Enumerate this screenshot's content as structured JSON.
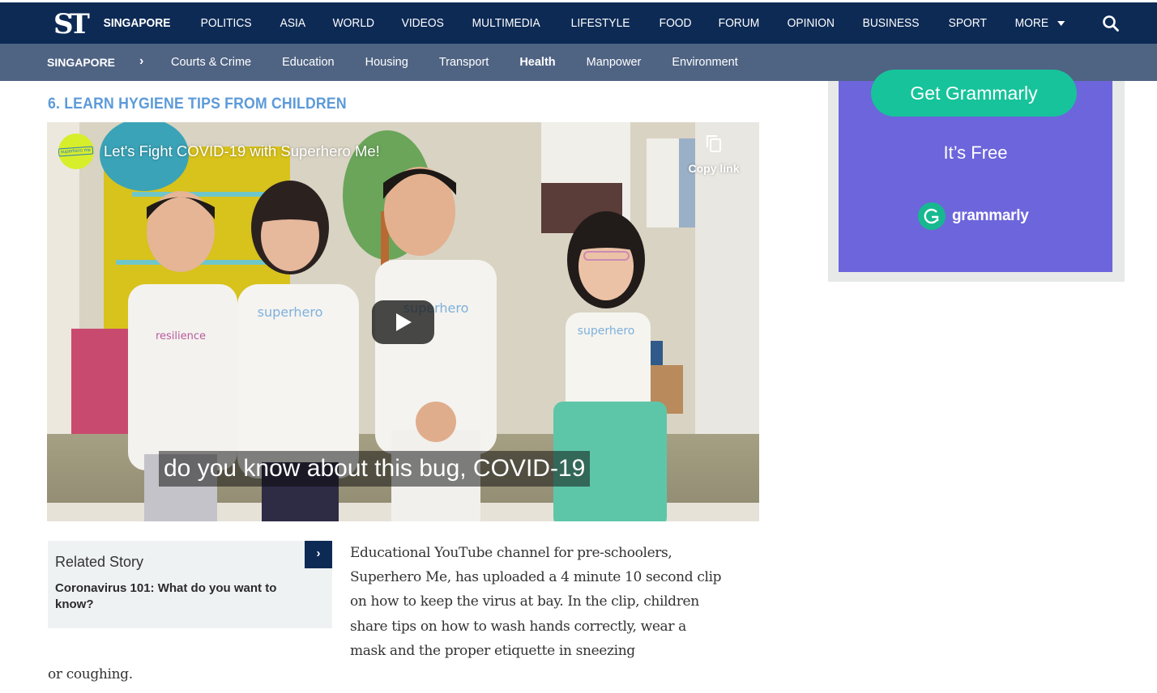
{
  "header": {
    "logo": "ST",
    "nav_items": [
      {
        "label": "SINGAPORE",
        "active": true
      },
      {
        "label": "POLITICS",
        "active": false
      },
      {
        "label": "ASIA",
        "active": false
      },
      {
        "label": "WORLD",
        "active": false
      },
      {
        "label": "VIDEOS",
        "active": false
      },
      {
        "label": "MULTIMEDIA",
        "active": false
      },
      {
        "label": "LIFESTYLE",
        "active": false
      },
      {
        "label": "FOOD",
        "active": false
      },
      {
        "label": "FORUM",
        "active": false
      },
      {
        "label": "OPINION",
        "active": false
      },
      {
        "label": "BUSINESS",
        "active": false
      },
      {
        "label": "SPORT",
        "active": false
      }
    ],
    "more_label": "MORE",
    "search_icon": "search-icon",
    "colors": {
      "nav_bg": "#0d2a55",
      "subnav_bg": "#4f6383"
    }
  },
  "subnav": {
    "section": "SINGAPORE",
    "separator_icon": "chevron-right-icon",
    "items": [
      {
        "label": "Courts & Crime",
        "active": false
      },
      {
        "label": "Education",
        "active": false
      },
      {
        "label": "Housing",
        "active": false
      },
      {
        "label": "Transport",
        "active": false
      },
      {
        "label": "Health",
        "active": true
      },
      {
        "label": "Manpower",
        "active": false
      },
      {
        "label": "Environment",
        "active": false
      }
    ]
  },
  "article": {
    "section_heading": "6. LEARN HYGIENE TIPS FROM CHILDREN",
    "heading_color": "#5c9ad8",
    "video": {
      "channel_avatar_text": "superhero me",
      "title": "Let's Fight COVID-19 with Superhero Me!",
      "copy_link_label": "Copy link",
      "caption": "do you know about this bug, COVID-19",
      "play_icon": "play-icon"
    },
    "related_story": {
      "label": "Related Story",
      "title": "Coronavirus 101: What do you want to know?",
      "arrow": "›"
    },
    "body": "Educational YouTube channel for pre-schoolers, Superhero Me, has uploaded a 4 minute 10 second clip on how to keep the virus at bay. In the clip, children share tips on how to wash hands correctly, wear a mask and the proper etiquette in sneezing",
    "body_tail": "or coughing."
  },
  "ad": {
    "cta_label": "Get Grammarly",
    "tagline": "It’s Free",
    "brand_name": "grammarly",
    "colors": {
      "bg": "#6d65db",
      "cta": "#17c39b"
    }
  }
}
